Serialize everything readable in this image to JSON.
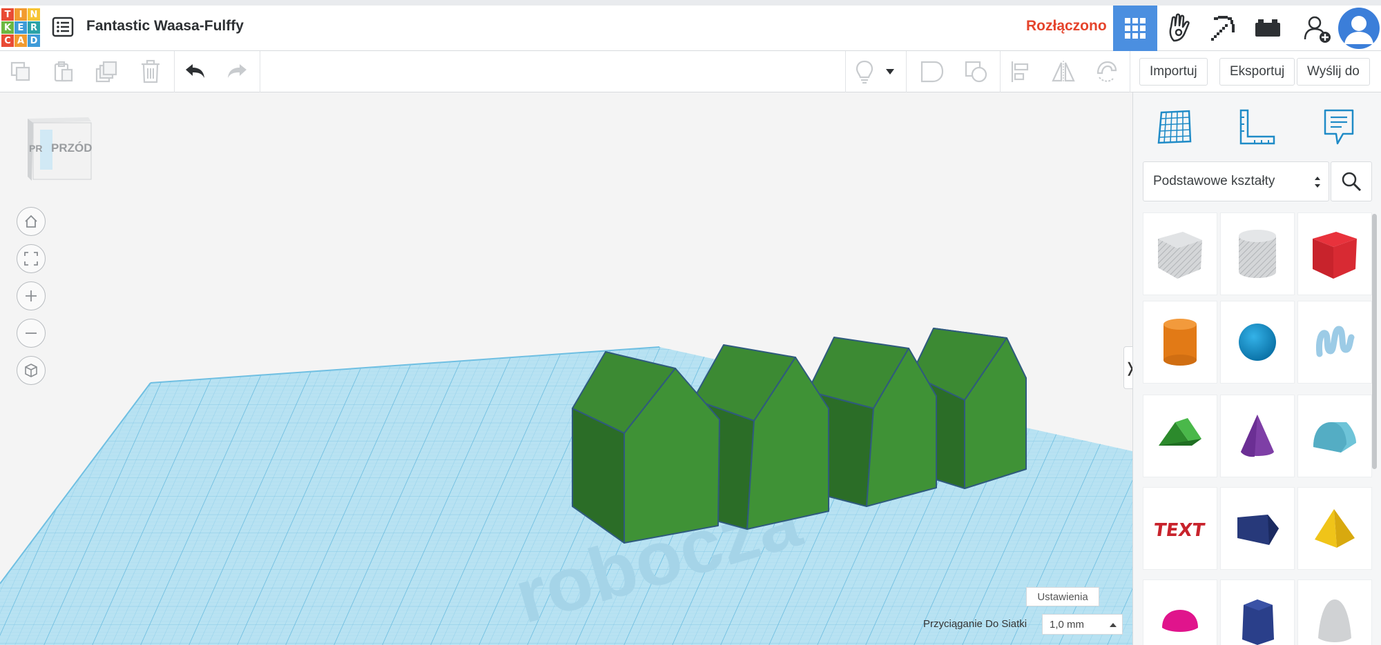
{
  "app": {
    "logo_letters": [
      "T",
      "I",
      "N",
      "K",
      "E",
      "R",
      "C",
      "A",
      "D"
    ],
    "logo_colors": [
      "#e94b35",
      "#f29b30",
      "#f7c433",
      "#6cb842",
      "#3e9bd8",
      "#2ba3a8",
      "#e94b35",
      "#f29b30",
      "#3e9bd8"
    ],
    "project_title": "Fantastic Waasa-Fulffy",
    "connection_status": "Rozłączono"
  },
  "header_buttons": [
    "3d-design-view-icon",
    "circuits-hand-icon",
    "minecraft-pickaxe-icon",
    "lego-brick-icon",
    "add-user-icon",
    "user-avatar-icon"
  ],
  "toolbar": {
    "import_label": "Importuj",
    "export_label": "Eksportuj",
    "send_label": "Wyślij do"
  },
  "workspace": {
    "view_cube_label": "PRZÓD",
    "view_cube_side": "PR",
    "workplane_text": "robocza",
    "settings_label": "Ustawienia",
    "snap_label": "Przyciąganie Do Siatki",
    "snap_value": "1,0 mm"
  },
  "panel": {
    "library_select": "Podstawowe kształty",
    "shapes": [
      "box-hole",
      "cylinder-hole",
      "box",
      "cylinder",
      "sphere",
      "scribble",
      "roof",
      "cone",
      "round-roof",
      "text",
      "wedge",
      "pyramid",
      "half-sphere",
      "polygon",
      "paraboloid"
    ]
  },
  "colors": {
    "accent": "#4b8fe0",
    "status": "#e5442c",
    "shape_green": "#3c8a33",
    "grid_blue": "#9fd6ee"
  }
}
